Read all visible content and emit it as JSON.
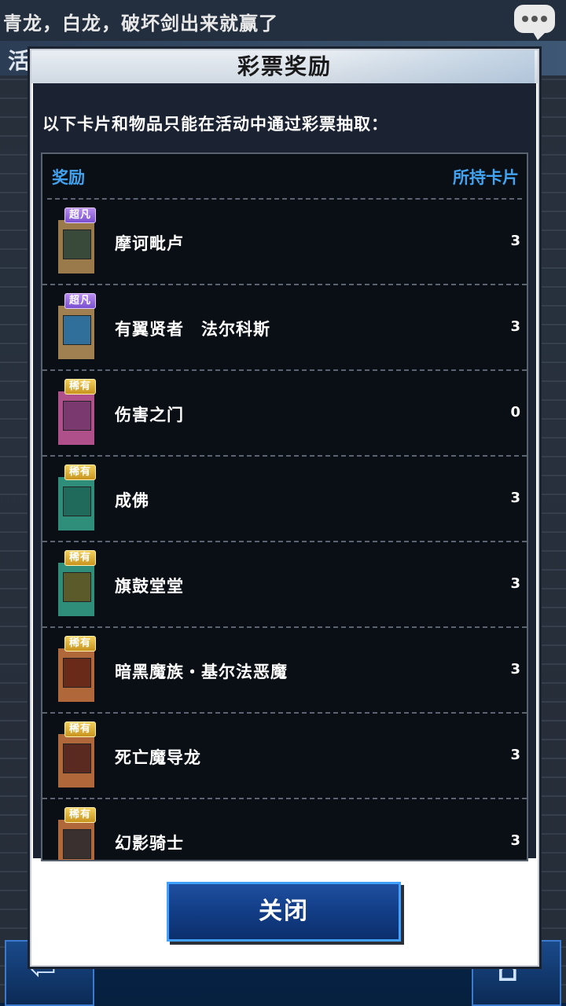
{
  "background": {
    "chat_text": "青龙，白龙，破坏剑出来就赢了",
    "event_text": "活动"
  },
  "dialog": {
    "title": "彩票奖励",
    "description": "以下卡片和物品只能在活动中通过彩票抽取：",
    "header_reward": "奖励",
    "header_owned": "所持卡片",
    "close_label": "关闭"
  },
  "rewards": [
    {
      "rarity": "超凡",
      "rarity_type": "sr",
      "name": "摩诃毗卢",
      "count": "3",
      "card_color": "#3a4a3a",
      "frame_color": "#9a7a4a"
    },
    {
      "rarity": "超凡",
      "rarity_type": "sr",
      "name": "有翼贤者　法尔科斯",
      "count": "3",
      "card_color": "#2f6f9a",
      "frame_color": "#a08050"
    },
    {
      "rarity": "稀有",
      "rarity_type": "r",
      "name": "伤害之门",
      "count": "0",
      "card_color": "#7a3a70",
      "frame_color": "#b0508a"
    },
    {
      "rarity": "稀有",
      "rarity_type": "r",
      "name": "成佛",
      "count": "3",
      "card_color": "#1f6a5a",
      "frame_color": "#2e8e7a"
    },
    {
      "rarity": "稀有",
      "rarity_type": "r",
      "name": "旗鼓堂堂",
      "count": "3",
      "card_color": "#5a5a2a",
      "frame_color": "#2e8e7a"
    },
    {
      "rarity": "稀有",
      "rarity_type": "r",
      "name": "暗黑魔族・基尔法恶魔",
      "count": "3",
      "card_color": "#6a2a1a",
      "frame_color": "#b0683a"
    },
    {
      "rarity": "稀有",
      "rarity_type": "r",
      "name": "死亡魔导龙",
      "count": "3",
      "card_color": "#5a2a20",
      "frame_color": "#b0683a"
    },
    {
      "rarity": "稀有",
      "rarity_type": "r",
      "name": "幻影骑士",
      "count": "3",
      "card_color": "#3a3030",
      "frame_color": "#b0683a"
    }
  ],
  "icons": {
    "chat": "chat-bubble-icon",
    "back": "back-arrow-icon",
    "home": "home-icon"
  }
}
